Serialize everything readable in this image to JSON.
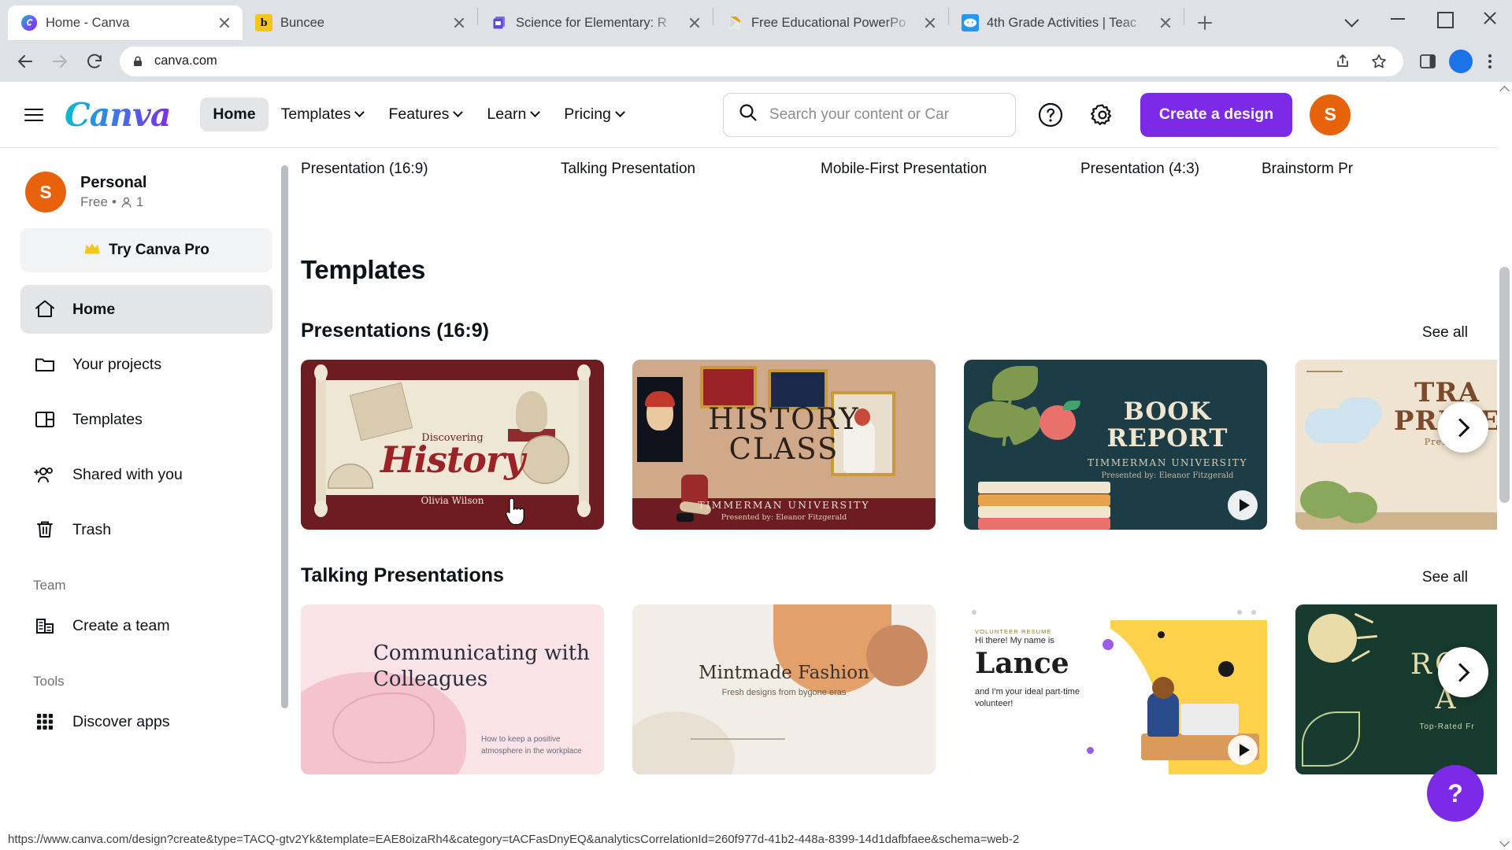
{
  "browser": {
    "tabs": [
      {
        "title": "Home - Canva",
        "favicon_name": "canva-favicon",
        "favicon_letter": "C",
        "favicon_color": "#7d2ae8",
        "active": true
      },
      {
        "title": "Buncee",
        "favicon_name": "buncee-favicon",
        "favicon_letter": "b",
        "favicon_color": "#f5c518",
        "active": false
      },
      {
        "title": "Science for Elementary: R",
        "favicon_name": "slides-favicon",
        "favicon_letter": "",
        "favicon_color": "#6b5ce7",
        "active": false
      },
      {
        "title": "Free Educational PowerPo",
        "favicon_name": "powerpoint-favicon",
        "favicon_letter": "",
        "favicon_color": "#f2a33c",
        "active": false
      },
      {
        "title": "4th Grade Activities | Teac",
        "favicon_name": "twinkl-favicon",
        "favicon_letter": "",
        "favicon_color": "#2196f3",
        "active": false
      }
    ],
    "new_tab_label": "New tab",
    "window_controls": [
      "minimize-list",
      "minimize",
      "maximize",
      "close"
    ],
    "toolbar": {
      "back_label": "Back",
      "forward_label": "Forward",
      "reload_label": "Reload",
      "url": "canva.com",
      "lock_icon": "lock-icon",
      "share_icon": "share-icon",
      "bookmark_icon": "star-icon",
      "sidepanel_icon": "side-panel-icon",
      "profile_icon": "profile-avatar",
      "menu_icon": "kebab-menu-icon"
    },
    "status_bar_url": "https://www.canva.com/design?create&type=TACQ-gtv2Yk&template=EAE8oizaRh4&category=tACFasDnyEQ&analyticsCorrelationId=260f977d-41b2-448a-8399-14d1dafbfaee&schema=web-2"
  },
  "topnav": {
    "menu_icon": "hamburger-menu-icon",
    "logo_text": "Canva",
    "items": [
      {
        "label": "Home",
        "has_caret": false,
        "selected": true
      },
      {
        "label": "Templates",
        "has_caret": true,
        "selected": false
      },
      {
        "label": "Features",
        "has_caret": true,
        "selected": false
      },
      {
        "label": "Learn",
        "has_caret": true,
        "selected": false
      },
      {
        "label": "Pricing",
        "has_caret": true,
        "selected": false
      }
    ],
    "search": {
      "placeholder": "Search your content or Car",
      "icon": "search-icon"
    },
    "help_icon": "help-circle-icon",
    "settings_icon": "gear-icon",
    "create_button": "Create a design",
    "create_button_color": "#7d2ae8",
    "avatar_letter": "S",
    "avatar_color": "#e8620c"
  },
  "sidebar": {
    "account": {
      "avatar_letter": "S",
      "avatar_color": "#e8620c",
      "name": "Personal",
      "plan": "Free",
      "separator": "•",
      "members_icon": "person-icon",
      "members_count": "1"
    },
    "pro_button": {
      "label": "Try Canva Pro",
      "icon": "crown-icon"
    },
    "items": [
      {
        "label": "Home",
        "icon": "home-icon",
        "active": true
      },
      {
        "label": "Your projects",
        "icon": "folder-icon",
        "active": false
      },
      {
        "label": "Templates",
        "icon": "layout-icon",
        "active": false
      },
      {
        "label": "Shared with you",
        "icon": "shared-users-icon",
        "active": false
      },
      {
        "label": "Trash",
        "icon": "trash-icon",
        "active": false
      }
    ],
    "group_team": "Team",
    "team_items": [
      {
        "label": "Create a team",
        "icon": "building-icon"
      }
    ],
    "group_tools": "Tools",
    "tool_items": [
      {
        "label": "Discover apps",
        "icon": "apps-grid-icon"
      }
    ]
  },
  "main": {
    "categories": [
      "Presentation (16:9)",
      "Talking Presentation",
      "Mobile-First Presentation",
      "Presentation (4:3)",
      "Brainstorm Pr"
    ],
    "page_title": "Templates",
    "sections": [
      {
        "title": "Presentations (16:9)",
        "see_all": "See all",
        "next_label": "Next",
        "cards": [
          {
            "art": "c1",
            "name": "discovering-history-template",
            "line1": "Discovering",
            "line2": "History",
            "line3": "Olivia Wilson",
            "video": false
          },
          {
            "art": "c2",
            "name": "history-class-template",
            "line1": "HISTORY",
            "line2": "CLASS",
            "line3": "TIMMERMAN UNIVERSITY",
            "line4": "Presented by: Eleanor Fitzgerald",
            "video": false
          },
          {
            "art": "c3",
            "name": "book-report-template",
            "line1": "BOOK",
            "line2": "REPORT",
            "line3": "TIMMERMAN UNIVERSITY",
            "line4": "Presented by: Eleanor Fitzgerald",
            "video": true
          },
          {
            "art": "c4",
            "name": "travel-presentation-template",
            "line1": "TRA",
            "line2": "PRESE",
            "line3": "Presenta",
            "video": false
          }
        ]
      },
      {
        "title": "Talking Presentations",
        "see_all": "See all",
        "next_label": "Next",
        "cards": [
          {
            "art": "d1",
            "name": "communicating-with-colleagues-template",
            "line1": "Communicating with Colleagues",
            "line3": "How to keep a positive atmosphere in the workplace",
            "video": false
          },
          {
            "art": "d2",
            "name": "mintmade-fashion-template",
            "line1": "Mintmade Fashion",
            "line2": "Fresh designs from bygone eras",
            "video": false
          },
          {
            "art": "d3",
            "name": "lance-volunteer-resume-template",
            "eyebrow": "VOLUNTEER RESUME",
            "line1": "Hi there! My name is",
            "line2": "Lance",
            "line3": "and I'm your ideal part-time volunteer!",
            "video": true
          },
          {
            "art": "d4",
            "name": "rosa-presentation-template",
            "line1": "ROS",
            "line2": "A",
            "line3": "Top-Rated Fr",
            "video": false
          }
        ]
      }
    ],
    "help_fab": "?"
  }
}
